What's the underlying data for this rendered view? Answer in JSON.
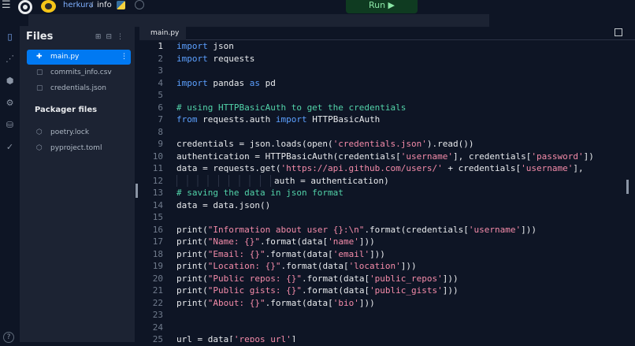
{
  "topbar": {
    "username": "herkura",
    "separator": "/",
    "repl_name": "info",
    "run_label": "Run ▶"
  },
  "rail": {
    "icons": [
      "files-icon",
      "share-icon",
      "packages-icon",
      "settings-icon",
      "database-icon",
      "check-icon",
      "help-icon"
    ],
    "help_label": "?"
  },
  "sidebar": {
    "title": "Files",
    "files": [
      {
        "name": "main.py",
        "active": true
      },
      {
        "name": "commits_info.csv",
        "active": false
      },
      {
        "name": "credentials.json",
        "active": false
      }
    ],
    "packager_title": "Packager files",
    "packager_files": [
      {
        "name": "poetry.lock"
      },
      {
        "name": "pyproject.toml"
      }
    ]
  },
  "editor": {
    "tab": "main.py",
    "current_line": 1,
    "line_numbers": [
      "1",
      "2",
      "3",
      "4",
      "5",
      "6",
      "7",
      "8",
      "9",
      "10",
      "11",
      "12",
      "13",
      "14",
      "15",
      "16",
      "17",
      "18",
      "19",
      "20",
      "21",
      "22",
      "23",
      "24",
      "25"
    ]
  },
  "code": {
    "l1": [
      "import",
      " json"
    ],
    "l2": [
      "import",
      " requests"
    ],
    "l4": [
      "import",
      " pandas ",
      "as",
      " pd"
    ],
    "l6": "# using HTTPBasicAuth to get the credentials",
    "l7": [
      "from",
      " requests.auth ",
      "import",
      " HTTPBasicAuth"
    ],
    "l9": [
      "credentials = json.loads(open(",
      "'credentials.json'",
      ").read())"
    ],
    "l10": [
      "authentication = HTTPBasicAuth(credentials[",
      "'username'",
      "], credentials[",
      "'password'",
      "])"
    ],
    "l11": [
      "data = requests.get(",
      "'https://api.github.com/users/'",
      " + credentials[",
      "'username'",
      "],"
    ],
    "l12": [
      "auth = authentication)"
    ],
    "l13": "# saving the data in json format",
    "l14": [
      "data = data.json()"
    ],
    "l16": [
      "print(",
      "\"Information about user {}:\\n\"",
      ".format(credentials[",
      "'username'",
      "]))"
    ],
    "l17": [
      "print(",
      "\"Name: {}\"",
      ".format(data[",
      "'name'",
      "]))"
    ],
    "l18": [
      "print(",
      "\"Email: {}\"",
      ".format(data[",
      "'email'",
      "]))"
    ],
    "l19": [
      "print(",
      "\"Location: {}\"",
      ".format(data[",
      "'location'",
      "]))"
    ],
    "l20": [
      "print(",
      "\"Public repos: {}\"",
      ".format(data[",
      "'public_repos'",
      "]))"
    ],
    "l21": [
      "print(",
      "\"Public gists: {}\"",
      ".format(data[",
      "'public_gists'",
      "]))"
    ],
    "l22": [
      "print(",
      "\"About: {}\"",
      ".format(data[",
      "'bio'",
      "]))"
    ],
    "l25": [
      "url = data[",
      "'repos_url'",
      "]"
    ]
  }
}
